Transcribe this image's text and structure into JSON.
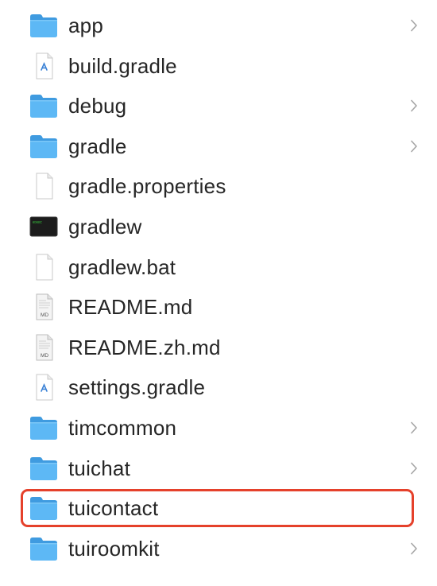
{
  "files": [
    {
      "name": "app",
      "icon": "folder-icon",
      "expandable": true
    },
    {
      "name": "build.gradle",
      "icon": "gradle-script-icon",
      "expandable": false
    },
    {
      "name": "debug",
      "icon": "folder-icon",
      "expandable": true
    },
    {
      "name": "gradle",
      "icon": "folder-icon",
      "expandable": true
    },
    {
      "name": "gradle.properties",
      "icon": "blank-document-icon",
      "expandable": false
    },
    {
      "name": "gradlew",
      "icon": "terminal-executable-icon",
      "expandable": false
    },
    {
      "name": "gradlew.bat",
      "icon": "blank-document-icon",
      "expandable": false
    },
    {
      "name": "README.md",
      "icon": "markdown-file-icon",
      "expandable": false
    },
    {
      "name": "README.zh.md",
      "icon": "markdown-file-icon",
      "expandable": false
    },
    {
      "name": "settings.gradle",
      "icon": "gradle-script-icon",
      "expandable": false
    },
    {
      "name": "timcommon",
      "icon": "folder-icon",
      "expandable": true
    },
    {
      "name": "tuichat",
      "icon": "folder-icon",
      "expandable": true
    },
    {
      "name": "tuicontact",
      "icon": "folder-icon",
      "expandable": false,
      "highlighted": true
    },
    {
      "name": "tuiroomkit",
      "icon": "folder-icon",
      "expandable": true
    }
  ],
  "icon_labels": {
    "markdown_badge": "MD",
    "terminal_text": "exec"
  },
  "colors": {
    "folder_back": "#3f9be0",
    "folder_front": "#5db8f5",
    "text": "#262626",
    "chevron": "#a5a5a5",
    "highlight": "#e5412b"
  }
}
